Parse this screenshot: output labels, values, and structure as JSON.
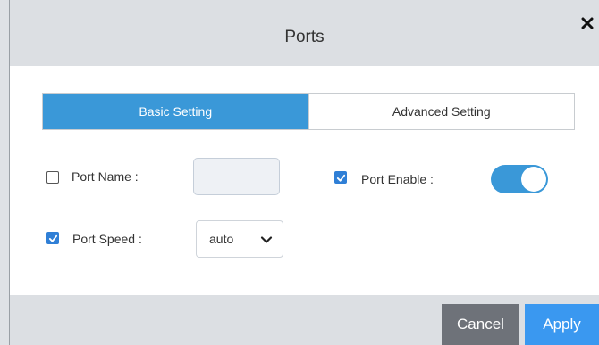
{
  "dialog": {
    "title": "Ports",
    "close_glyph": "✕"
  },
  "tabs": [
    {
      "label": "Basic Setting",
      "active": true
    },
    {
      "label": "Advanced Setting",
      "active": false
    }
  ],
  "fields": {
    "port_name": {
      "label": "Port Name :",
      "checked": false,
      "value": ""
    },
    "port_enable": {
      "label": "Port Enable :",
      "checked": true,
      "toggle_on": true
    },
    "port_speed": {
      "label": "Port Speed :",
      "checked": true,
      "selected": "auto"
    }
  },
  "footer": {
    "cancel_label": "Cancel",
    "apply_label": "Apply"
  },
  "colors": {
    "accent": "#3a98d8",
    "header_bg": "#dcdfe3",
    "cancel_bg": "#6e7279",
    "apply_bg": "#3a98f0",
    "checkbox": "#2f7fd6"
  }
}
